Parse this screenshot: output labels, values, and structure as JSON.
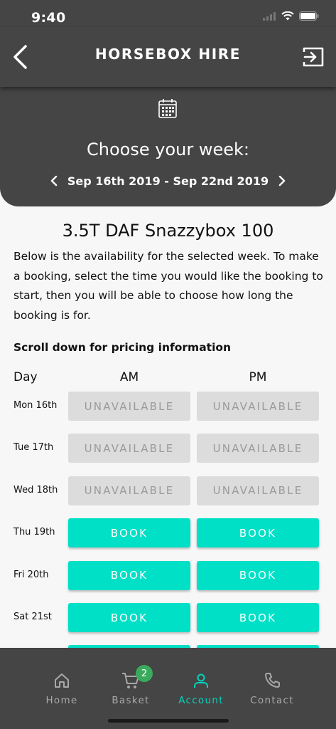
{
  "status_bar": {
    "time": "9:40"
  },
  "header": {
    "title": "HORSEBOX HIRE",
    "choose_label": "Choose your week:",
    "week_range": "Sep 16th 2019 - Sep 22nd 2019"
  },
  "product": {
    "title": "3.5T DAF Snazzybox 100",
    "description": "Below is the availability for the selected week. To make a booking, select the time you would like the booking to start, then you will be able to choose how long the booking is for.",
    "scroll_note": "Scroll down for pricing information"
  },
  "table": {
    "headers": {
      "day": "Day",
      "am": "AM",
      "pm": "PM"
    },
    "rows": [
      {
        "day": "Mon 16th",
        "am": "UNAVAILABLE",
        "pm": "UNAVAILABLE"
      },
      {
        "day": "Tue 17th",
        "am": "UNAVAILABLE",
        "pm": "UNAVAILABLE"
      },
      {
        "day": "Wed 18th",
        "am": "UNAVAILABLE",
        "pm": "UNAVAILABLE"
      },
      {
        "day": "Thu 19th",
        "am": "BOOK",
        "pm": "BOOK"
      },
      {
        "day": "Fri 20th",
        "am": "BOOK",
        "pm": "BOOK"
      },
      {
        "day": "Sat 21st",
        "am": "BOOK",
        "pm": "BOOK"
      },
      {
        "day": "",
        "am": "",
        "pm": ""
      }
    ]
  },
  "tabbar": {
    "items": [
      {
        "label": "Home",
        "icon": "home-icon"
      },
      {
        "label": "Basket",
        "icon": "cart-icon",
        "badge": "2"
      },
      {
        "label": "Account",
        "icon": "user-icon"
      },
      {
        "label": "Contact",
        "icon": "phone-icon"
      }
    ]
  },
  "colors": {
    "header_bg": "#454545",
    "accent": "#00e0c6",
    "unavailable_bg": "#dcdcdc",
    "badge": "#3aaa5c"
  }
}
